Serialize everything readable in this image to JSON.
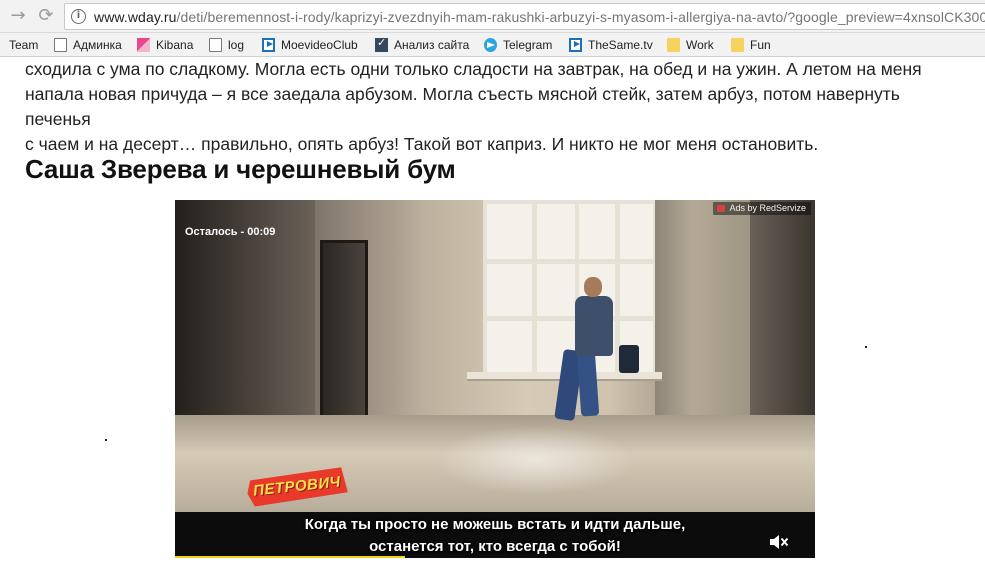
{
  "browser": {
    "url_host": "www.wday.ru",
    "url_path": "/deti/beremennost-i-rody/kaprizyi-zvezdnyih-mam-rakushki-arbuzyi-s-myasom-i-allergiya-na-avto/?google_preview=4xnsolCK300",
    "bookmarks": [
      {
        "label": "Team",
        "icon": "none"
      },
      {
        "label": "Админка",
        "icon": "file-icon"
      },
      {
        "label": "Kibana",
        "icon": "kibana-icon"
      },
      {
        "label": "log",
        "icon": "file-icon"
      },
      {
        "label": "MoevideoClub",
        "icon": "moevideo-icon"
      },
      {
        "label": "Анализ сайта",
        "icon": "checkmark-icon"
      },
      {
        "label": "Telegram",
        "icon": "telegram-icon"
      },
      {
        "label": "TheSame.tv",
        "icon": "moevideo-icon"
      },
      {
        "label": "Work",
        "icon": "folder-icon"
      },
      {
        "label": "Fun",
        "icon": "folder-icon"
      }
    ]
  },
  "article": {
    "paragraph_lines": [
      "сходила с ума по сладкому. Могла есть одни только сладости на завтрак, на обед и на ужин. А летом на меня",
      "напала новая причуда – я все заедала арбузом. Могла съесть мясной стейк, затем арбуз, потом навернуть печенья",
      "с чаем и на десерт… правильно, опять арбуз! Такой вот каприз. И никто не мог меня остановить."
    ],
    "heading": "Саша Зверева и черешневый бум"
  },
  "video_ad": {
    "ads_label": "Ads by RedServize",
    "brand_logo": "ПЕТРОВИЧ",
    "subtitle_line1": "Когда ты просто не можешь встать и идти дальше,",
    "subtitle_line2": "останется тот, кто всегда с тобой!",
    "remaining_text": "Осталось - 00:09",
    "progress_fraction": 0.36,
    "progress_color": "#f3d21a",
    "mute_icon": "speaker-muted-icon"
  }
}
